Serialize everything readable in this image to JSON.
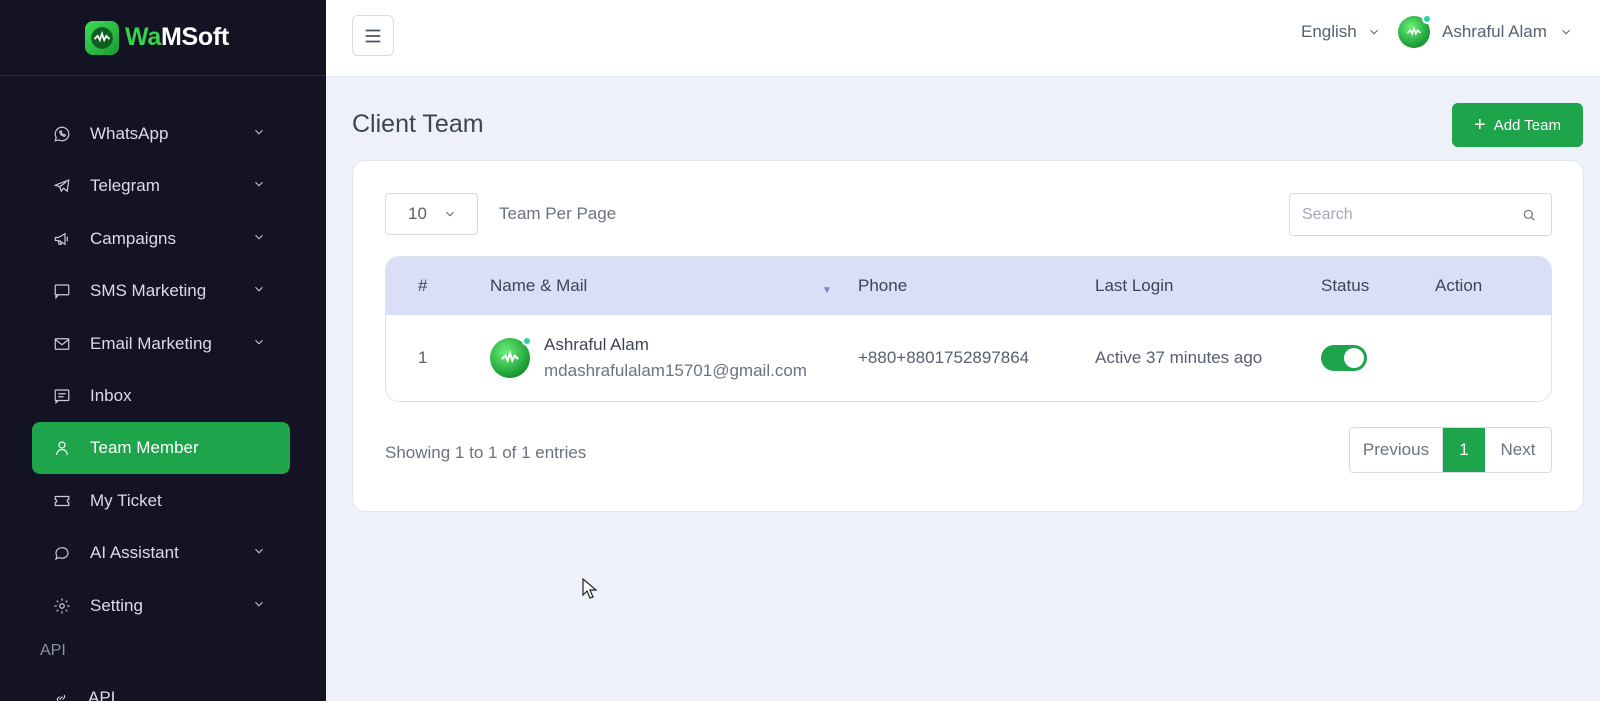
{
  "app": {
    "logo_wa": "Wa",
    "logo_rest": "MSoft"
  },
  "sidebar": {
    "items": [
      {
        "label": "WhatsApp",
        "icon": "whatsapp-icon",
        "has_chevron": true
      },
      {
        "label": "Telegram",
        "icon": "telegram-icon",
        "has_chevron": true
      },
      {
        "label": "Campaigns",
        "icon": "megaphone-icon",
        "has_chevron": true
      },
      {
        "label": "SMS Marketing",
        "icon": "sms-icon",
        "has_chevron": true
      },
      {
        "label": "Email Marketing",
        "icon": "mail-icon",
        "has_chevron": true
      },
      {
        "label": "Inbox",
        "icon": "inbox-icon",
        "has_chevron": false
      },
      {
        "label": "Team Member",
        "icon": "user-icon",
        "has_chevron": false,
        "active": true
      },
      {
        "label": "My Ticket",
        "icon": "ticket-icon",
        "has_chevron": false
      },
      {
        "label": "AI Assistant",
        "icon": "chat-icon",
        "has_chevron": true
      },
      {
        "label": "Setting",
        "icon": "gear-icon",
        "has_chevron": true
      }
    ],
    "section_label": "API",
    "api_item": "API"
  },
  "header": {
    "language": "English",
    "user_name": "Ashraful Alam"
  },
  "page": {
    "title": "Client Team",
    "add_button": "Add Team"
  },
  "table_controls": {
    "per_page_value": "10",
    "per_page_label": "Team Per Page",
    "search_placeholder": "Search"
  },
  "table": {
    "columns": [
      "#",
      "Name & Mail",
      "Phone",
      "Last Login",
      "Status",
      "Action"
    ],
    "rows": [
      {
        "index": "1",
        "name": "Ashraful Alam",
        "email": "mdashrafulalam15701@gmail.com",
        "phone": "+880+8801752897864",
        "last_login": "Active 37 minutes ago",
        "status_on": true
      }
    ]
  },
  "footer": {
    "showing": "Showing 1 to 1 of 1 entries",
    "prev": "Previous",
    "page": "1",
    "next": "Next"
  },
  "colors": {
    "sidebar_bg": "#131324",
    "accent_green": "#1ea44b",
    "table_header_bg": "#dadff8",
    "page_bg": "#eef1f9"
  }
}
